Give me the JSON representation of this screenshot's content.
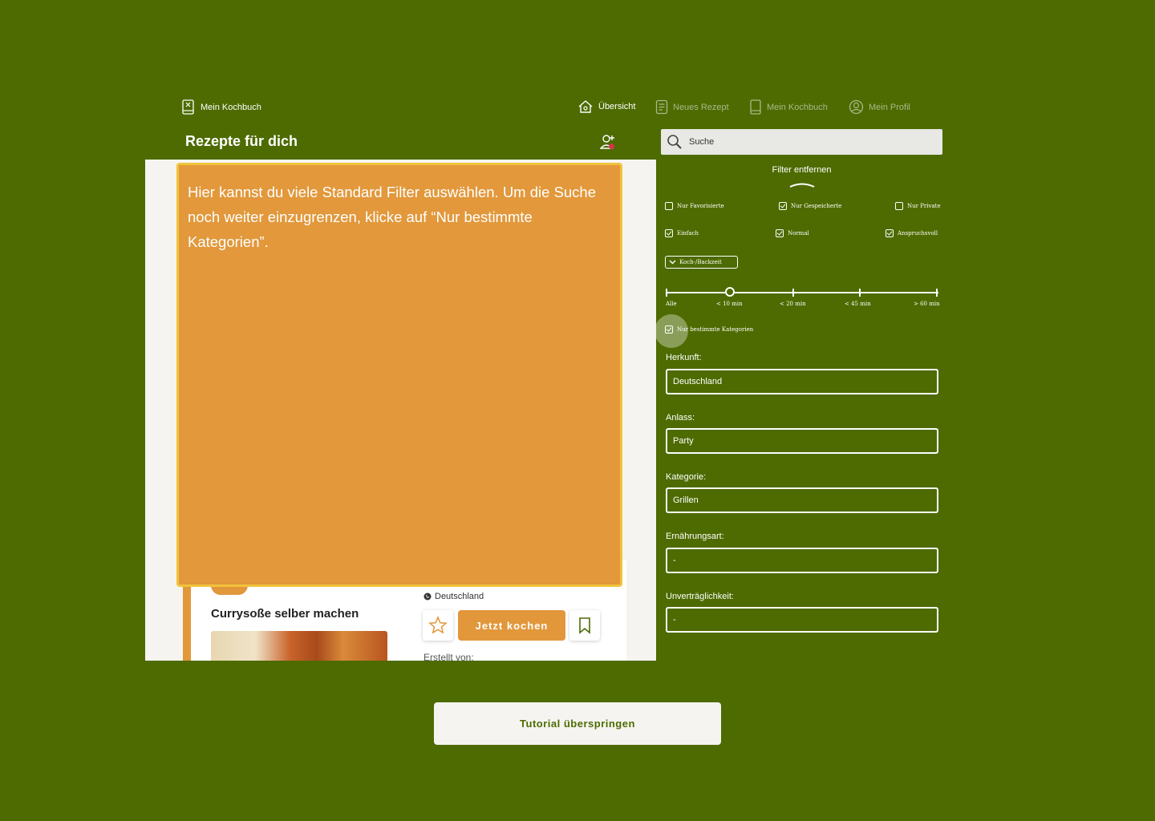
{
  "brand": {
    "label": "Mein Kochbuch"
  },
  "nav": {
    "overview": "Übersicht",
    "new_recipe": "Neues Rezept",
    "my_cookbook": "Mein Kochbuch",
    "my_profile": "Mein Profil"
  },
  "page_title": "Rezepte für dich",
  "search": {
    "placeholder": "Suche"
  },
  "filters": {
    "remove_label": "Filter entfernen",
    "row1": [
      {
        "label": "Nur Favorisierte",
        "checked": false
      },
      {
        "label": "Nur Gespeicherte",
        "checked": true
      },
      {
        "label": "Nur Private",
        "checked": false
      }
    ],
    "row2": [
      {
        "label": "Einfach",
        "checked": true
      },
      {
        "label": "Normal",
        "checked": true
      },
      {
        "label": "Anspruchsvoll",
        "checked": true
      }
    ],
    "time_dropdown": "Koch-/Backzeit",
    "time_slider": {
      "labels": [
        "Alle",
        "< 10 min",
        "< 20 min",
        "< 45 min",
        "> 60 min"
      ],
      "selected": "< 10 min"
    },
    "categories_only": {
      "label": "Nur bestimmte Kategorien",
      "checked": true
    },
    "fields": [
      {
        "label": "Herkunft:",
        "value": "Deutschland"
      },
      {
        "label": "Anlass:",
        "value": "Party"
      },
      {
        "label": "Kategorie:",
        "value": "Grillen"
      },
      {
        "label": "Ernährungsart:",
        "value": "-"
      },
      {
        "label": "Unverträglichkeit:",
        "value": "-"
      }
    ]
  },
  "recipe_card": {
    "title": "Currysoße selber machen",
    "origin": "Deutschland",
    "cook_button": "Jetzt kochen",
    "created_by": "Erstellt von:"
  },
  "tooltip": {
    "text": "Hier kannst du viele Standard Filter auswählen. Um die Suche noch weiter einzugrenzen, klicke auf “Nur bestimmte Kategorien”."
  },
  "skip_button": "Tutorial überspringen",
  "colors": {
    "background": "#4d6b00",
    "accent": "#e2983b",
    "tooltip_border": "#f1c33c",
    "panel": "#f5f4f0"
  }
}
